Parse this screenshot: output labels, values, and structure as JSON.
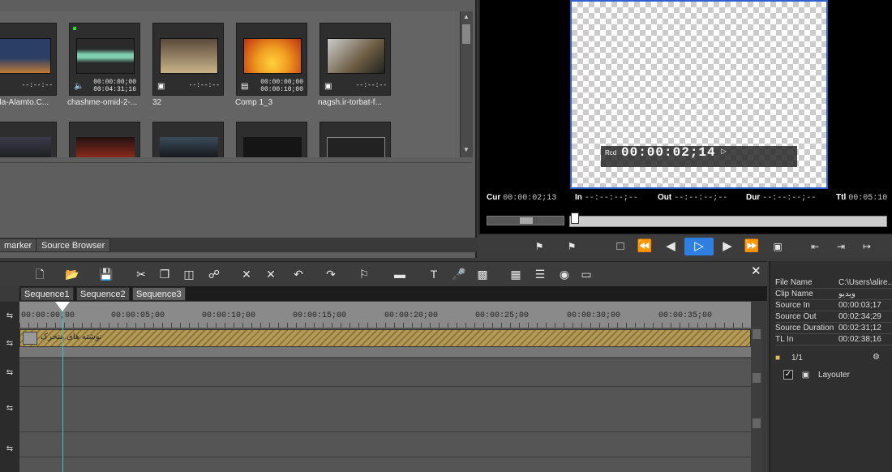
{
  "bin": {
    "clips": [
      {
        "name": "ala-Alamto.C...",
        "tc_top": "--:--:--",
        "tc_bot": "",
        "icon": "camera-icon",
        "thumb": [
          "#2a3e66",
          "#c07a35"
        ],
        "dot": false
      },
      {
        "name": "chashme-omid-2-...",
        "tc_top": "00:00:00;00",
        "tc_bot": "00:04:31;16",
        "icon": "speaker-icon",
        "thumb": [
          "#2a2a2a",
          "#7fd0b0"
        ],
        "dot": true
      },
      {
        "name": "32",
        "tc_top": "--:--:--",
        "tc_bot": "",
        "icon": "camera-icon",
        "thumb": [
          "#5a4a3a",
          "#c9b38a"
        ],
        "dot": false
      },
      {
        "name": "Comp 1_3",
        "tc_top": "00:00:00;00",
        "tc_bot": "00:00:10;00",
        "icon": "film-icon",
        "thumb": [
          "#f0a020",
          "#c03010"
        ],
        "dot": false
      },
      {
        "name": "nagsh.ir-torbat-f...",
        "tc_top": "--:--:--",
        "tc_bot": "",
        "icon": "camera-icon",
        "thumb": [
          "#cccccc",
          "#6a5a40"
        ],
        "dot": false
      }
    ],
    "tabs": [
      "marker",
      "Source Browser"
    ]
  },
  "preview": {
    "rcd_label": "Rcd",
    "rcd_tc": "00:00:02;14",
    "cur_label": "Cur",
    "cur": "00:00:02;13",
    "in_label": "In",
    "in": "--:--:--;--",
    "out_label": "Out",
    "out": "--:--:--;--",
    "dur_label": "Dur",
    "dur": "--:--:--;--",
    "ttl_label": "Ttl",
    "ttl": "00:05:10"
  },
  "timeline": {
    "sequences": [
      "Sequence1",
      "Sequence2",
      "Sequence3"
    ],
    "ruler": [
      "00:00:00;00",
      "00:00:05;00",
      "00:00:10;00",
      "00:00:15;00",
      "00:00:20;00",
      "00:00:25;00",
      "00:00:30;00",
      "00:00:35;00"
    ],
    "clip_label": "نوشته های متحرک"
  },
  "info": {
    "rows": [
      {
        "k": "File Name",
        "v": "C:\\Users\\alire..."
      },
      {
        "k": "Clip Name",
        "v": "ویدیو"
      },
      {
        "k": "Source In",
        "v": "00:00:03;17"
      },
      {
        "k": "Source Out",
        "v": "00:02:34;29"
      },
      {
        "k": "Source Duration",
        "v": "00:02:31;12"
      },
      {
        "k": "TL In",
        "v": "00:02:38;16"
      }
    ],
    "count": "1/1",
    "layer": "Layouter"
  },
  "accent": "#2f7fe0"
}
